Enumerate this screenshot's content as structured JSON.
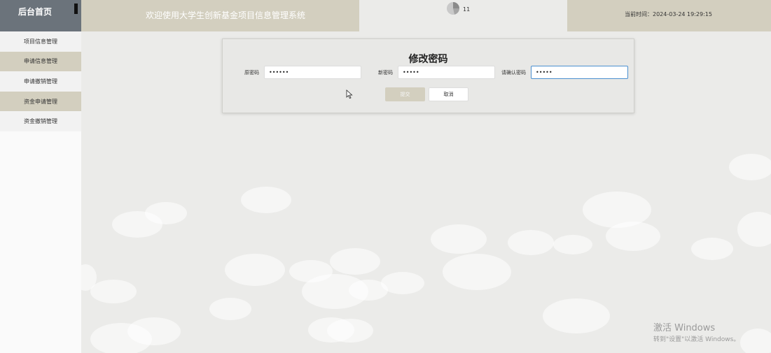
{
  "header": {
    "brand": "后台首页",
    "title": "欢迎使用大学生创新基金项目信息管理系统",
    "loader_count": "11",
    "time_label": "当前时间：",
    "time_value": "2024-03-24 19:29:15"
  },
  "sidebar": {
    "items": [
      {
        "label": "项目信息管理"
      },
      {
        "label": "申请信息管理"
      },
      {
        "label": "申请撤销管理"
      },
      {
        "label": "资金申请管理"
      },
      {
        "label": "资金撤销管理"
      }
    ]
  },
  "dialog": {
    "title": "修改密码",
    "fields": [
      {
        "label": "原密码",
        "value": "••••••"
      },
      {
        "label": "新密码",
        "value": "•••••"
      },
      {
        "label": "请确认密码",
        "value": "•••••"
      }
    ],
    "submit_label": "提交",
    "cancel_label": "取消"
  },
  "watermark": {
    "line1": "激活 Windows",
    "line2": "转到\"设置\"以激活 Windows。"
  },
  "colors": {
    "brand_bg": "#6b737b",
    "accent": "#d3cfbf",
    "page_bg": "#ebebe9",
    "focus": "#4a8fd0"
  }
}
